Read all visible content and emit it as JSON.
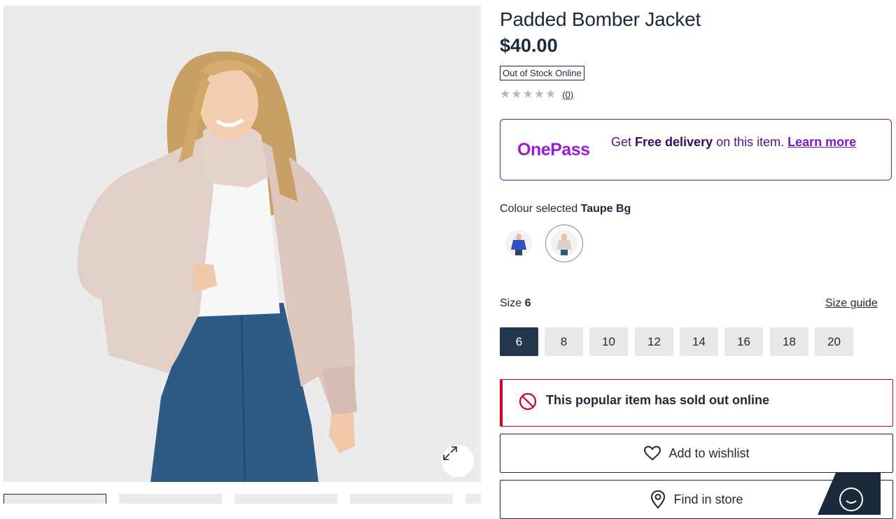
{
  "product": {
    "title": "Padded Bomber Jacket",
    "price": "$40.00",
    "stock_badge": "Out of Stock Online",
    "rating": {
      "stars_filled": 0,
      "stars_total": 5,
      "review_count": "(0)"
    }
  },
  "onepass": {
    "logo": "OnePass",
    "text_pre": "Get ",
    "text_bold": "Free delivery",
    "text_post": " on this item. ",
    "link": "Learn more",
    "brand_color": "#9b1cd6"
  },
  "colour": {
    "label": "Colour selected",
    "selected": "Taupe Bg",
    "swatches": [
      {
        "name": "Blue",
        "selected": false
      },
      {
        "name": "Taupe Bg",
        "selected": true
      }
    ]
  },
  "size": {
    "label": "Size",
    "selected": "6",
    "guide_label": "Size guide",
    "options": [
      "6",
      "8",
      "10",
      "12",
      "14",
      "16",
      "18",
      "20"
    ]
  },
  "alert": {
    "text": "This popular item has sold out online",
    "color": "#d0021b",
    "icon": "prohibited-icon"
  },
  "actions": {
    "wishlist_label": "Add to wishlist",
    "store_label": "Find in store"
  },
  "icons": {
    "expand": "expand-icon",
    "heart": "heart-icon",
    "location": "location-pin-icon",
    "chat": "chat-icon"
  }
}
